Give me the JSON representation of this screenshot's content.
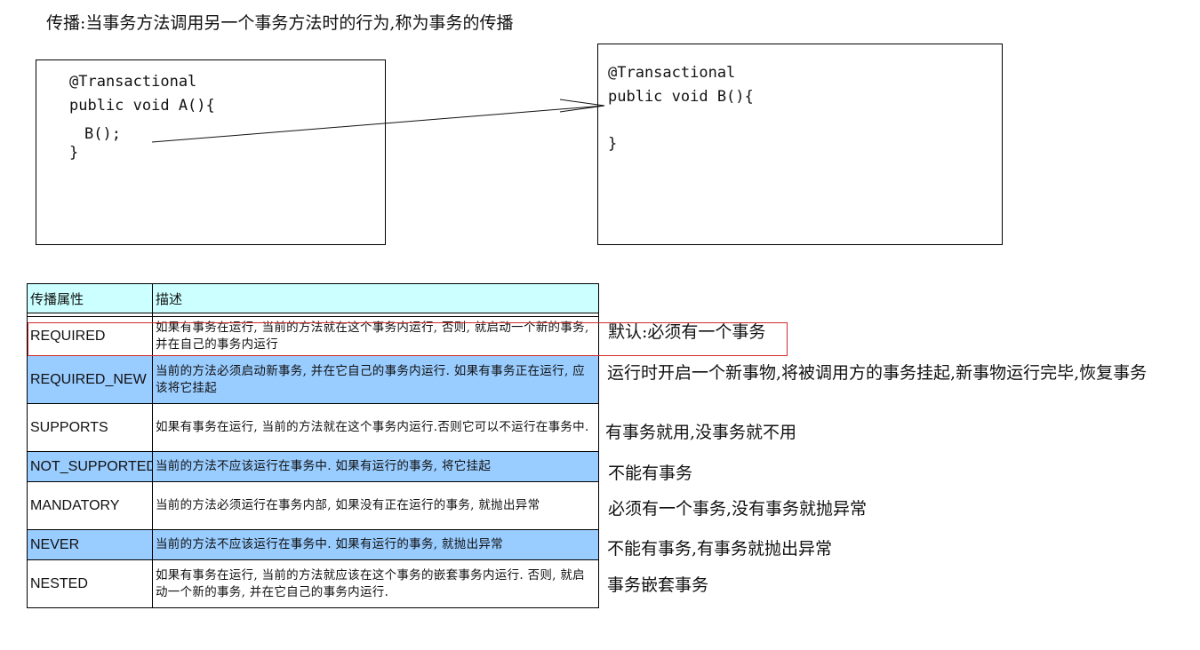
{
  "heading": "传播:当事务方法调用另一个事务方法时的行为,称为事务的传播",
  "method_a": {
    "annotation": "@Transactional",
    "signature": "public void A(){",
    "call": "B();",
    "close": "}"
  },
  "method_b": {
    "annotation": "@Transactional",
    "signature": "public void B(){",
    "close": "}"
  },
  "table": {
    "headers": [
      "传播属性",
      "描述"
    ],
    "rows": [
      {
        "name": "REQUIRED",
        "desc": "如果有事务在运行, 当前的方法就在这个事务内运行, 否则, 就启动一个新的事务, 并在自己的事务内运行",
        "note": "默认:必须有一个事务"
      },
      {
        "name": "REQUIRED_NEW",
        "desc": "当前的方法必须启动新事务, 并在它自己的事务内运行. 如果有事务正在运行, 应该将它挂起",
        "note": "运行时开启一个新事物,将被调用方的事务挂起,新事物运行完毕,恢复事务"
      },
      {
        "name": "SUPPORTS",
        "desc": "如果有事务在运行, 当前的方法就在这个事务内运行.否则它可以不运行在事务中.",
        "note": "有事务就用,没事务就不用"
      },
      {
        "name": "NOT_SUPPORTED",
        "desc": "当前的方法不应该运行在事务中. 如果有运行的事务, 将它挂起",
        "note": "不能有事务"
      },
      {
        "name": "MANDATORY",
        "desc": "当前的方法必须运行在事务内部, 如果没有正在运行的事务, 就抛出异常",
        "note": "必须有一个事务,没有事务就抛异常"
      },
      {
        "name": "NEVER",
        "desc": "当前的方法不应该运行在事务中. 如果有运行的事务, 就抛出异常",
        "note": "不能有事务,有事务就抛出异常"
      },
      {
        "name": "NESTED",
        "desc": "如果有事务在运行, 当前的方法就应该在这个事务的嵌套事务内运行. 否则, 就启动一个新的事务, 并在它自己的事务内运行.",
        "note": "事务嵌套事务"
      }
    ]
  },
  "colors": {
    "header_bg": "#ccffff",
    "row_blue": "#99ccff",
    "row_white": "#ffffff",
    "highlight": "#d42a2a"
  }
}
